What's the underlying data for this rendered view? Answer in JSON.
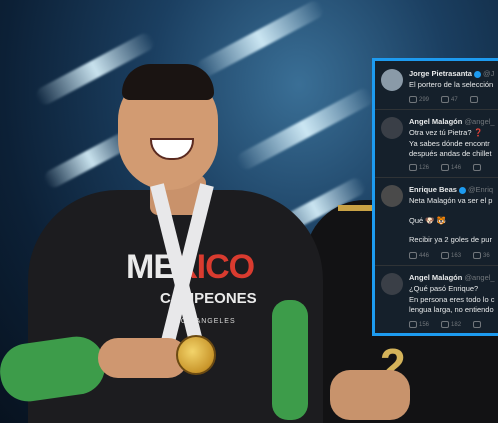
{
  "shirt": {
    "country_prefix": "ME",
    "country_accent": "XICO",
    "subtitle": "CAMPEONES",
    "city": "LOS ANGELES"
  },
  "jersey_number": "2",
  "tweets": [
    {
      "name": "Jorge Pietrasanta",
      "handle": "@J",
      "lines": [
        "El portero de la selección"
      ],
      "stats": [
        "299",
        "47",
        ""
      ]
    },
    {
      "name": "Angel Malagón",
      "handle": "@angel_",
      "lines": [
        "Otra vez tú Pietra? ❓",
        "Ya sabes dónde encontr",
        "después andas de chillet"
      ],
      "stats": [
        "126",
        "146",
        ""
      ]
    },
    {
      "name": "Enrique Beas",
      "handle": "@Enriq",
      "lines": [
        "Neta Malagón va ser el p",
        "",
        "Qué 🐶 🐯",
        "",
        "Recibir ya 2 goles de pur"
      ],
      "stats": [
        "446",
        "163",
        "36"
      ]
    },
    {
      "name": "Angel Malagón",
      "handle": "@angel_",
      "lines": [
        "¿Qué pasó Enrique?",
        "En persona eres todo lo c",
        "lengua larga, no entiendo"
      ],
      "stats": [
        "156",
        "182",
        ""
      ]
    }
  ]
}
